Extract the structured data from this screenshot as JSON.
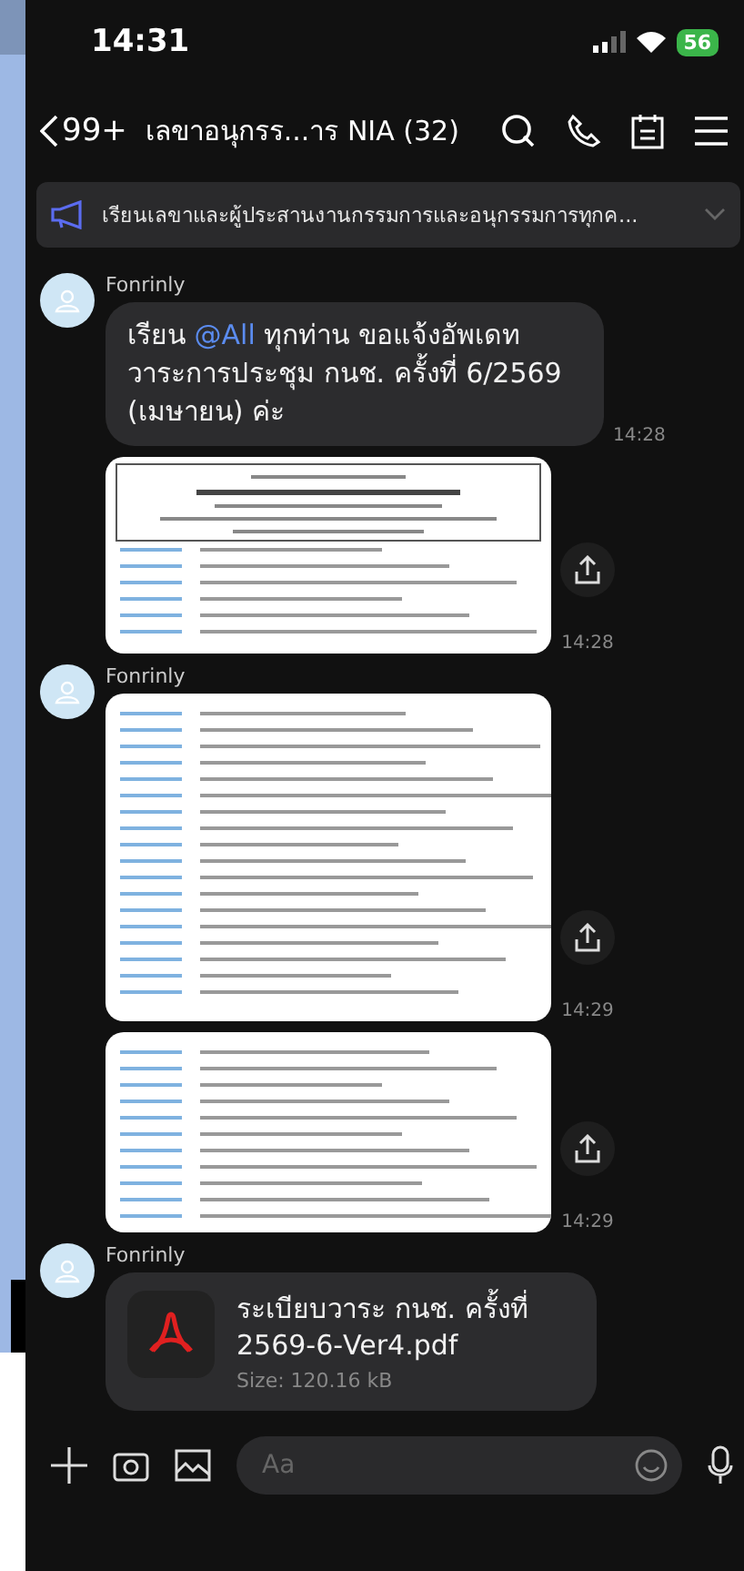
{
  "status_bar": {
    "time": "14:31",
    "battery": "56"
  },
  "header": {
    "back_count": "99+",
    "title": "เลขาอนุกรร...าร NIA (32)"
  },
  "announcement": {
    "text": "เรียนเลขาและผู้ประสานงานกรรมการและอนุกรรมการทุกค..."
  },
  "messages": [
    {
      "kind": "text",
      "sender": "Fonrinly",
      "parts": [
        {
          "text": "เรียน "
        },
        {
          "text": "@All",
          "mention": true
        },
        {
          "text": " ทุกท่าน ขอแจ้งอัพเดท วาระการประชุม กนช. ครั้งที่ 6/2569 (เมษายน) ค่ะ"
        }
      ],
      "time": "14:28"
    },
    {
      "kind": "image",
      "time": "14:28"
    },
    {
      "kind": "image",
      "sender": "Fonrinly",
      "time": "14:29"
    },
    {
      "kind": "image",
      "time": "14:29"
    },
    {
      "kind": "file",
      "sender": "Fonrinly",
      "file_name": "ระเบียบวาระ กนช. ครั้งที่ 2569-6-Ver4.pdf",
      "size": "Size: 120.16 kB"
    }
  ],
  "composer": {
    "placeholder": "Aa"
  }
}
